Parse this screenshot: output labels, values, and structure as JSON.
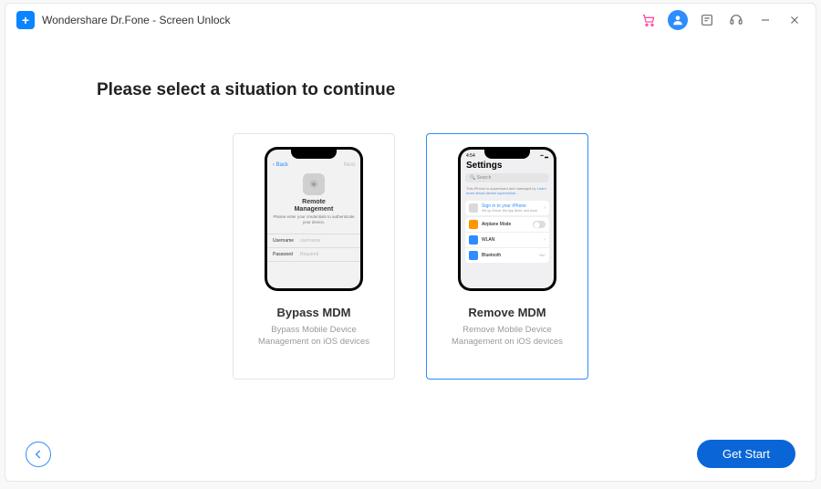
{
  "titlebar": {
    "app_name": "Wondershare Dr.Fone - Screen Unlock"
  },
  "heading": "Please select a situation to continue",
  "cards": {
    "bypass": {
      "title": "Bypass MDM",
      "desc": "Bypass Mobile Device Management on iOS devices",
      "phone": {
        "back": "Back",
        "next": "Next",
        "center_title": "Remote\nManagement",
        "center_sub": "Please enter your credentials to authenticate your device.",
        "username_label": "Username",
        "username_ph": "username",
        "password_label": "Password",
        "password_ph": "Required"
      }
    },
    "remove": {
      "title": "Remove MDM",
      "desc": "Remove Mobile Device Management on iOS devices",
      "phone": {
        "time": "4:54",
        "settings_title": "Settings",
        "search_ph": "Search",
        "info_text": "This iPhone is supervised and managed by",
        "info_link": "Learn more about device supervision...",
        "signin_title": "Sign in to your iPhone",
        "signin_sub": "Set up iCloud, the App Store, and more.",
        "airplane": "Airplane Mode",
        "wlan": "WLAN",
        "bluetooth": "Bluetooth",
        "bt_val": "On"
      }
    }
  },
  "footer": {
    "start": "Get Start"
  }
}
